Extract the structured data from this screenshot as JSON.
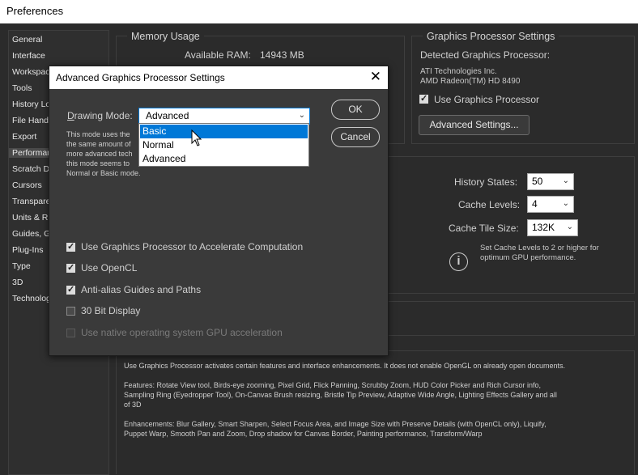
{
  "window": {
    "title": "Preferences"
  },
  "sidebar": {
    "items": [
      {
        "label": "General"
      },
      {
        "label": "Interface"
      },
      {
        "label": "Workspac"
      },
      {
        "label": "Tools"
      },
      {
        "label": "History Lo"
      },
      {
        "label": "File Handli"
      },
      {
        "label": "Export"
      },
      {
        "label": "Performan"
      },
      {
        "label": "Scratch D"
      },
      {
        "label": "Cursors"
      },
      {
        "label": "Transpare"
      },
      {
        "label": "Units & Ru"
      },
      {
        "label": "Guides, G"
      },
      {
        "label": "Plug-Ins"
      },
      {
        "label": "Type"
      },
      {
        "label": "3D"
      },
      {
        "label": "Technolog"
      }
    ],
    "selected_label": "Performan"
  },
  "memory": {
    "title": "Memory Usage",
    "available_label": "Available RAM:",
    "available_value": "14943 MB"
  },
  "gpu": {
    "title": "Graphics Processor Settings",
    "detected_label": "Detected Graphics Processor:",
    "vendor": "ATI Technologies Inc.",
    "model": "AMD Radeon(TM) HD 8490",
    "use_gpu_label": "Use Graphics Processor",
    "use_gpu_checked": true,
    "advanced_button": "Advanced Settings..."
  },
  "history": {
    "states_label": "History States:",
    "states_value": "50",
    "levels_label": "Cache Levels:",
    "levels_value": "4",
    "tile_label": "Cache Tile Size:",
    "tile_value": "132K",
    "tip_line1": "Set Cache Levels to 2 or higher for",
    "tip_line2": "optimum GPU performance.",
    "info_icon": "info-icon"
  },
  "description": {
    "p1": "Use Graphics Processor activates certain features and interface enhancements. It does not enable OpenGL on already open documents.",
    "p2_line1": "Features: Rotate View tool, Birds-eye zooming, Pixel Grid, Flick Panning, Scrubby Zoom, HUD Color Picker and Rich Cursor info,",
    "p2_line2": "Sampling Ring (Eyedropper Tool), On-Canvas Brush resizing, Bristle Tip Preview, Adaptive Wide Angle, Lighting Effects Gallery and all",
    "p2_line3": "of 3D",
    "p3_line1": "Enhancements: Blur Gallery, Smart Sharpen, Select Focus Area, and Image Size with Preserve Details (with OpenCL only), Liquify,",
    "p3_line2": "Puppet Warp, Smooth Pan and Zoom, Drop shadow for Canvas Border, Painting performance, Transform/Warp"
  },
  "dialog": {
    "title": "Advanced Graphics Processor Settings",
    "close_icon": "close-icon",
    "drawing_mode_label": "Drawing Mode:",
    "drawing_mode_value": "Advanced",
    "drawing_mode_options": [
      "Basic",
      "Normal",
      "Advanced"
    ],
    "highlighted_option": "Basic",
    "desc_l1": "This mode uses the",
    "desc_l2": "the same amount of",
    "desc_l3": "more advanced tech",
    "desc_l4": "this mode seems to",
    "desc_l5": "Normal or Basic mode.",
    "ok": "OK",
    "cancel": "Cancel",
    "checkboxes": [
      {
        "label": "Use Graphics Processor to Accelerate Computation",
        "checked": true,
        "enabled": true
      },
      {
        "label": "Use OpenCL",
        "checked": true,
        "enabled": true
      },
      {
        "label": "Anti-alias Guides and Paths",
        "checked": true,
        "enabled": true
      },
      {
        "label": "30 Bit Display",
        "checked": false,
        "enabled": true
      },
      {
        "label": "Use native operating system GPU acceleration",
        "checked": false,
        "enabled": false
      }
    ]
  }
}
